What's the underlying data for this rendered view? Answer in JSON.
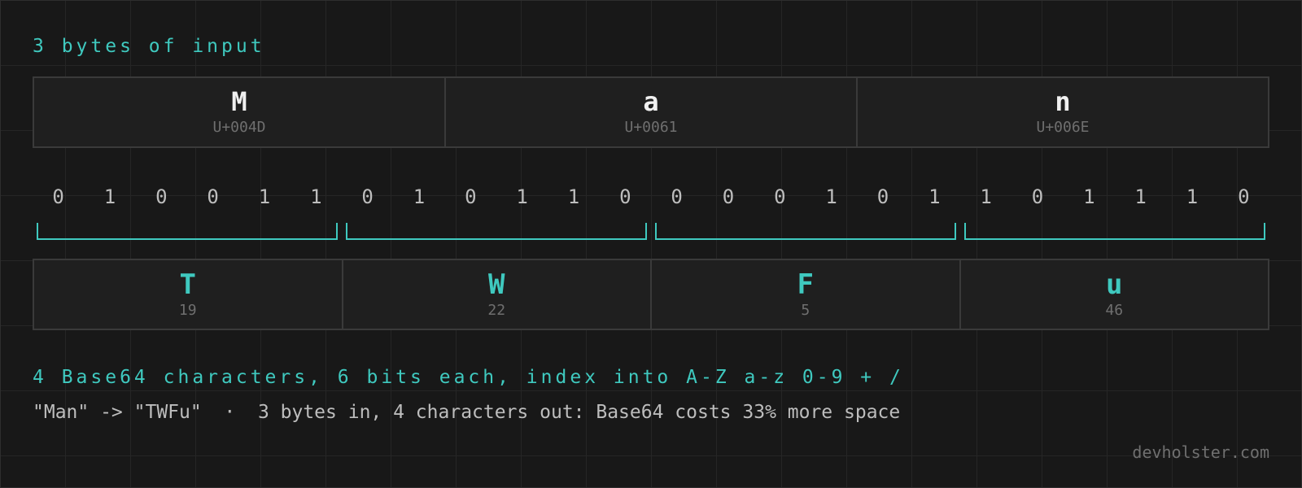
{
  "input_label": "3 bytes of input",
  "bytes": [
    {
      "char": "M",
      "code": "U+004D"
    },
    {
      "char": "a",
      "code": "U+0061"
    },
    {
      "char": "n",
      "code": "U+006E"
    }
  ],
  "bits": [
    "0",
    "1",
    "0",
    "0",
    "1",
    "1",
    "0",
    "1",
    "0",
    "1",
    "1",
    "0",
    "0",
    "0",
    "0",
    "1",
    "0",
    "1",
    "1",
    "0",
    "1",
    "1",
    "1",
    "0"
  ],
  "groups": [
    {
      "char": "T",
      "index": "19"
    },
    {
      "char": "W",
      "index": "22"
    },
    {
      "char": "F",
      "index": "5"
    },
    {
      "char": "u",
      "index": "46"
    }
  ],
  "output_label": "4 Base64 characters, 6 bits each, index into A-Z a-z 0-9 + /",
  "summary": "\"Man\" -> \"TWFu\"  ·  3 bytes in, 4 characters out: Base64 costs 33% more space",
  "footer": "devholster.com",
  "colors": {
    "accent": "#3fc9bf",
    "bracket": "#3fc9bf",
    "text": "#bdbdbd",
    "muted": "#6f6f6f"
  }
}
